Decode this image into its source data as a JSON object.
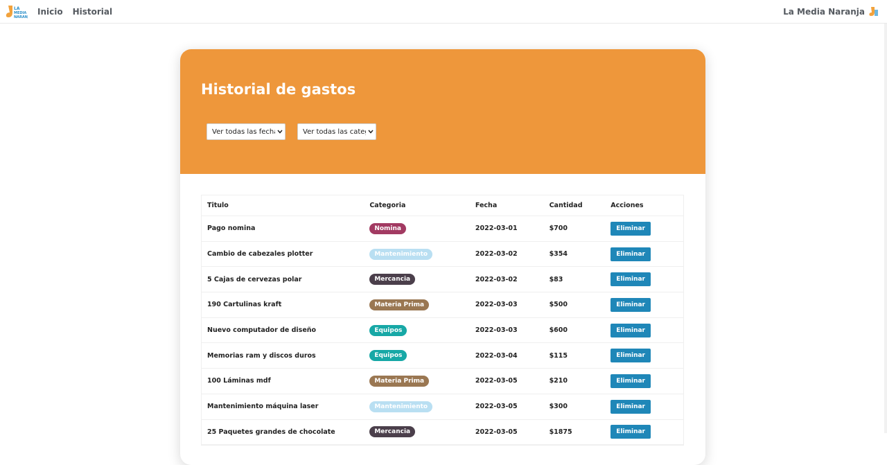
{
  "nav": {
    "logo_icon": "orange-sock-logo-icon",
    "links": [
      "Inicio",
      "Historial"
    ],
    "brand": "La Media Naranja",
    "brand_icon": "sock-icon"
  },
  "page": {
    "title": "Historial de gastos",
    "filters": {
      "dates": "Ver todas las fechas",
      "categories": "Ver todas las categorías"
    }
  },
  "colors": {
    "header": "#ee973b",
    "delete_button": "#1f87b8",
    "badges": {
      "Nomina": "#a23a62",
      "Mantenimiento": "#b9dff2",
      "Mercancia": "#4b3f4b",
      "Materia Prima": "#9a7752",
      "Equipos": "#17a8a6"
    }
  },
  "table": {
    "headers": [
      "Titulo",
      "Categoria",
      "Fecha",
      "Cantidad",
      "Acciones"
    ],
    "action_label": "Eliminar",
    "rows": [
      {
        "title": "Pago nomina",
        "category": "Nomina",
        "date": "2022-03-01",
        "amount": "$700"
      },
      {
        "title": "Cambio de cabezales plotter",
        "category": "Mantenimiento",
        "date": "2022-03-02",
        "amount": "$354"
      },
      {
        "title": "5 Cajas de cervezas polar",
        "category": "Mercancia",
        "date": "2022-03-02",
        "amount": "$83"
      },
      {
        "title": "190 Cartulinas kraft",
        "category": "Materia Prima",
        "date": "2022-03-03",
        "amount": "$500"
      },
      {
        "title": "Nuevo computador de diseño",
        "category": "Equipos",
        "date": "2022-03-03",
        "amount": "$600"
      },
      {
        "title": "Memorias ram y discos duros",
        "category": "Equipos",
        "date": "2022-03-04",
        "amount": "$115"
      },
      {
        "title": "100 Láminas mdf",
        "category": "Materia Prima",
        "date": "2022-03-05",
        "amount": "$210"
      },
      {
        "title": "Mantenimiento máquina laser",
        "category": "Mantenimiento",
        "date": "2022-03-05",
        "amount": "$300"
      },
      {
        "title": "25 Paquetes grandes de chocolate",
        "category": "Mercancia",
        "date": "2022-03-05",
        "amount": "$1875"
      }
    ]
  }
}
